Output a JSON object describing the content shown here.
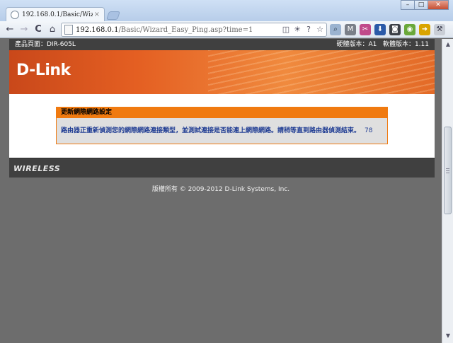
{
  "browser": {
    "tab_title": "192.168.0.1/Basic/Wizard_Eas",
    "tab_close": "×",
    "url_host": "192.168.0.1",
    "url_path": "/Basic/Wizard_Easy_Ping.asp?time=1",
    "window_controls": {
      "minimize": "–",
      "maximize": "□",
      "close": "✕"
    },
    "nav": {
      "back": "←",
      "forward": "→",
      "reload": "C",
      "home": "⌂"
    }
  },
  "header": {
    "product_page": "產品頁面：DIR-605L",
    "hw_version": "硬體版本：A1",
    "fw_version": "軟體版本：1.11"
  },
  "logo": "D-Link",
  "dialog": {
    "title": "更新網際網路設定",
    "message": "路由器正重新偵測您的網際網路連接類型，並測試連接是否能連上網際網路。請稍等直到路由器偵測結束。",
    "countdown": "78"
  },
  "footer": {
    "brand": "WIRELESS",
    "copyright": "版權所有 © 2009-2012 D-Link Systems, Inc."
  }
}
